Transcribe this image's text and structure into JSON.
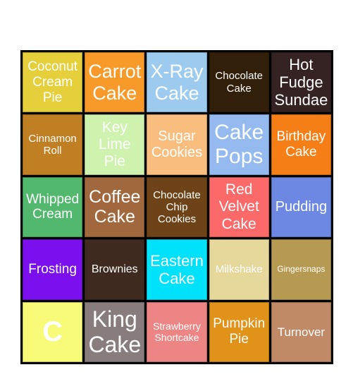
{
  "cells": [
    {
      "text": "Coconut\nCream\nPie",
      "color": "#e5d03c",
      "size": 19
    },
    {
      "text": "Carrot\nCake",
      "color": "#f79a2a",
      "size": 27
    },
    {
      "text": "X-Ray\nCake",
      "color": "#9dcbf0",
      "size": 27
    },
    {
      "text": "Chocolate\nCake",
      "color": "#311f09",
      "size": 15
    },
    {
      "text": "Hot\nFudge\nSundae",
      "color": "#352222",
      "size": 22
    },
    {
      "text": "Cinnamon\nRoll",
      "color": "#c07f22",
      "size": 15
    },
    {
      "text": "Key\nLime\nPie",
      "color": "#cff2ae",
      "size": 21
    },
    {
      "text": "Sugar\nCookies",
      "color": "#f9be7e",
      "size": 20
    },
    {
      "text": "Cake\nPops",
      "color": "#94baf0",
      "size": 30
    },
    {
      "text": "Birthday\nCake",
      "color": "#f57f16",
      "size": 19
    },
    {
      "text": "Whipped\nCream",
      "color": "#52b86e",
      "size": 19
    },
    {
      "text": "Coffee\nCake",
      "color": "#a0683c",
      "size": 25
    },
    {
      "text": "Chocolate\nChip\nCookies",
      "color": "#6e4317",
      "size": 15
    },
    {
      "text": "Red\nVelvet\nCake",
      "color": "#fb6969",
      "size": 21
    },
    {
      "text": "Pudding",
      "color": "#6c88e2",
      "size": 20
    },
    {
      "text": "Frosting",
      "color": "#7b0fee",
      "size": 19
    },
    {
      "text": "Brownies",
      "color": "#3e2a1e",
      "size": 16
    },
    {
      "text": "Eastern\nCake",
      "color": "#00e2fb",
      "size": 22
    },
    {
      "text": "Milkshake",
      "color": "#e6d79b",
      "size": 15
    },
    {
      "text": "Gingersnaps",
      "color": "#b79a52",
      "size": 12
    },
    {
      "text": "C",
      "color": "#f8fb78",
      "size": 40,
      "bold": true
    },
    {
      "text": "King\nCake",
      "color": "#887d7c",
      "size": 32
    },
    {
      "text": "Strawberry\nShortcake",
      "color": "#ee8585",
      "size": 14
    },
    {
      "text": "Pumpkin\nPie",
      "color": "#e09219",
      "size": 19
    },
    {
      "text": "Turnover",
      "color": "#c08a66",
      "size": 17
    }
  ]
}
